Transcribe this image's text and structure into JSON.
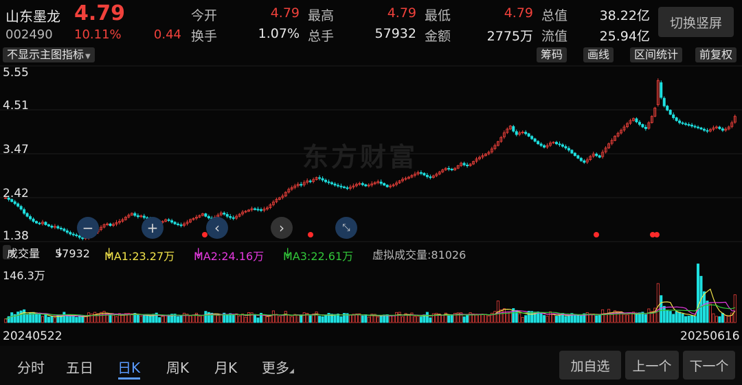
{
  "stock": {
    "name": "山东墨龙",
    "price": "4.79",
    "code": "002490",
    "change_pct": "10.11%",
    "change": "0.44"
  },
  "quote": {
    "open_label": "今开",
    "open": "4.79",
    "high_label": "最高",
    "high": "4.79",
    "low_label": "最低",
    "low": "4.79",
    "total_value_label": "总值",
    "total_value": "38.22亿",
    "turnover_label": "换手",
    "turnover": "1.07%",
    "total_hands_label": "总手",
    "total_hands": "57932",
    "amount_label": "金额",
    "amount": "2775万",
    "float_value_label": "流值",
    "float_value": "25.94亿"
  },
  "switch_label": "切换竖屏",
  "indicator_select": "不显示主图指标",
  "tools": [
    "筹码",
    "画线",
    "区间统计",
    "前复权"
  ],
  "y_ticks": [
    "5.55",
    "4.51",
    "3.47",
    "2.42",
    "1.38"
  ],
  "watermark": "东方财富",
  "volume": {
    "select_label": "成交量",
    "vol": "57932",
    "ma1": "MA1:23.27万",
    "ma2": "MA2:24.16万",
    "ma3": "MA3:22.61万",
    "virtual": "虚拟成交量:81026",
    "max_label": "146.3万"
  },
  "dates": {
    "start": "20240522",
    "end": "20250616"
  },
  "tabs": [
    "分时",
    "五日",
    "日K",
    "周K",
    "月K",
    "更多"
  ],
  "active_tab": "日K",
  "buttons": {
    "add": "加自选",
    "prev": "上一个",
    "next": "下一个"
  },
  "colors": {
    "up": "#f0413b",
    "down": "#1ee0e0",
    "ma1": "#f2e34a",
    "ma2": "#e53ae0",
    "ma3": "#32c83a",
    "accent": "#5b9bff"
  },
  "chart_data": {
    "type": "candlestick",
    "price_range": [
      1.38,
      5.55
    ],
    "close": [
      2.42,
      2.38,
      2.33,
      2.28,
      2.22,
      2.15,
      2.05,
      1.98,
      1.92,
      1.86,
      1.82,
      1.8,
      1.84,
      1.78,
      1.75,
      1.72,
      1.74,
      1.7,
      1.68,
      1.64,
      1.6,
      1.56,
      1.54,
      1.52,
      1.48,
      1.45,
      1.47,
      1.5,
      1.55,
      1.6,
      1.66,
      1.72,
      1.78,
      1.8,
      1.76,
      1.79,
      1.83,
      1.86,
      1.9,
      1.96,
      2.01,
      2.05,
      2.0,
      1.97,
      1.99,
      1.95,
      1.93,
      1.9,
      1.88,
      1.85,
      1.83,
      1.86,
      1.9,
      1.88,
      1.84,
      1.8,
      1.78,
      1.76,
      1.8,
      1.84,
      1.9,
      1.93,
      1.96,
      2.0,
      2.04,
      1.98,
      1.94,
      1.92,
      1.96,
      2.01,
      2.06,
      2.03,
      1.98,
      1.95,
      1.93,
      1.98,
      2.03,
      2.08,
      2.1,
      2.13,
      2.16,
      2.15,
      2.14,
      2.12,
      2.15,
      2.18,
      2.25,
      2.32,
      2.38,
      2.42,
      2.46,
      2.55,
      2.62,
      2.66,
      2.7,
      2.74,
      2.72,
      2.78,
      2.82,
      2.8,
      2.85,
      2.9,
      2.88,
      2.84,
      2.8,
      2.78,
      2.75,
      2.72,
      2.7,
      2.68,
      2.66,
      2.64,
      2.67,
      2.7,
      2.74,
      2.76,
      2.73,
      2.7,
      2.72,
      2.75,
      2.78,
      2.8,
      2.76,
      2.72,
      2.68,
      2.7,
      2.73,
      2.77,
      2.82,
      2.86,
      2.88,
      2.91,
      2.95,
      2.98,
      3.02,
      3.0,
      2.96,
      2.92,
      2.9,
      2.94,
      2.98,
      3.03,
      3.08,
      3.12,
      3.1,
      3.08,
      3.12,
      3.18,
      3.24,
      3.2,
      3.18,
      3.22,
      3.28,
      3.34,
      3.38,
      3.42,
      3.46,
      3.5,
      3.58,
      3.66,
      3.75,
      3.85,
      3.96,
      4.05,
      4.12,
      4.0,
      3.92,
      3.96,
      3.98,
      3.94,
      3.88,
      3.82,
      3.76,
      3.7,
      3.66,
      3.62,
      3.66,
      3.72,
      3.74,
      3.7,
      3.68,
      3.64,
      3.6,
      3.55,
      3.48,
      3.42,
      3.36,
      3.3,
      3.26,
      3.32,
      3.4,
      3.46,
      3.42,
      3.38,
      3.5,
      3.6,
      3.7,
      3.78,
      3.88,
      3.95,
      4.02,
      4.1,
      4.18,
      4.25,
      4.3,
      4.22,
      4.16,
      4.1,
      4.06,
      4.2,
      4.35,
      4.55,
      5.2,
      4.8,
      4.6,
      4.5,
      4.4,
      4.32,
      4.25,
      4.2,
      4.18,
      4.16,
      4.15,
      4.12,
      4.1,
      4.08,
      4.05,
      4.02,
      4.0,
      4.04,
      4.08,
      4.1,
      4.06,
      4.02,
      4.05,
      4.1,
      4.2,
      4.35
    ],
    "volume_max": "146.3万"
  }
}
